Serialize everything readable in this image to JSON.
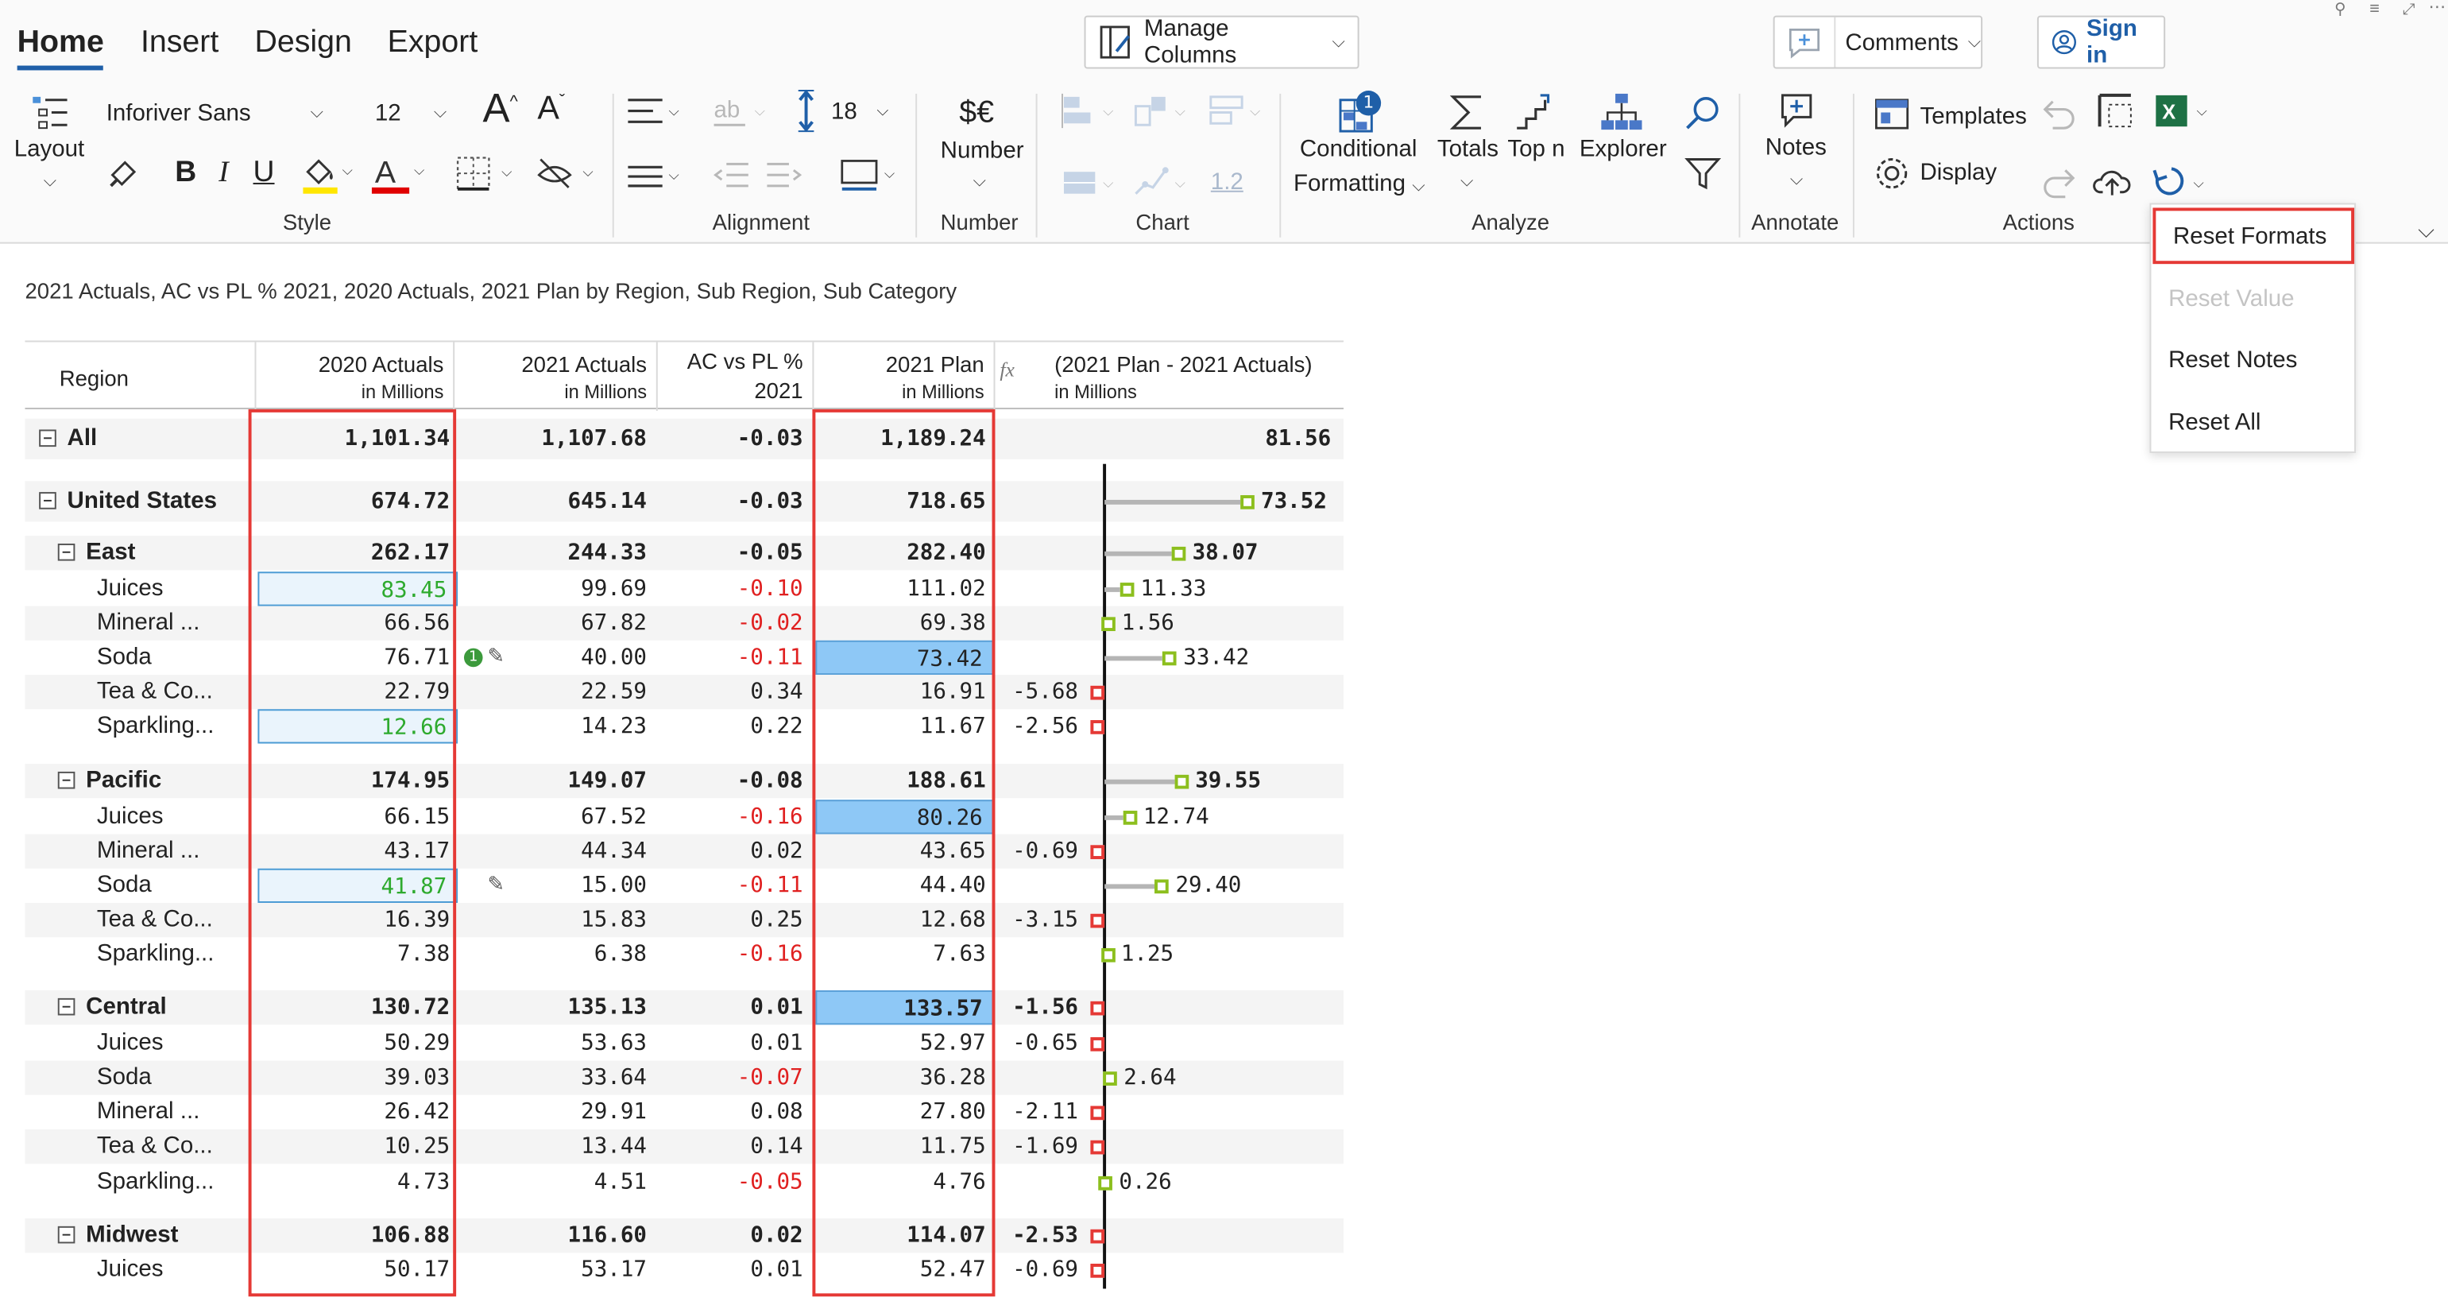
{
  "menu_tabs": [
    "Home",
    "Insert",
    "Design",
    "Export"
  ],
  "top": {
    "manage_columns": "Manage Columns",
    "comments": "Comments",
    "sign_in": "Sign in"
  },
  "style": {
    "layout_label": "Layout",
    "font_name": "Inforiver Sans",
    "font_size": "12",
    "bold": "B",
    "italic": "I",
    "underline": "U",
    "grow": "A",
    "shrink": "A",
    "group_label": "Style"
  },
  "alignment": {
    "row_height": "18",
    "group_label": "Alignment"
  },
  "number": {
    "symbol": "$€",
    "label": "Number",
    "group_label": "Number"
  },
  "chart": {
    "decimal": "1.2",
    "group_label": "Chart"
  },
  "analyze": {
    "conditional": "Conditional",
    "formatting": "Formatting",
    "badge": "1",
    "totals": "Totals",
    "topn": "Top n",
    "explorer": "Explorer",
    "group_label": "Analyze"
  },
  "annotate": {
    "notes": "Notes",
    "group_label": "Annotate"
  },
  "actions": {
    "templates": "Templates",
    "display": "Display",
    "group_label": "Actions",
    "excel": "X"
  },
  "reset_menu": [
    "Reset Formats",
    "Reset Value",
    "Reset Notes",
    "Reset All"
  ],
  "subtitle": "2021 Actuals, AC vs PL % 2021, 2020 Actuals, 2021 Plan by Region, Sub Region, Sub Category",
  "headers": {
    "region": "Region",
    "c2020_l1": "2020 Actuals",
    "c2020_l2": "in Millions",
    "c2021_l1": "2021 Actuals",
    "c2021_l2": "in Millions",
    "acpl_l1": "AC vs PL %",
    "acpl_l2": "2021",
    "plan_l1": "2021 Plan",
    "plan_l2": "in Millions",
    "fx": "fx",
    "diff_l1": "(2021 Plan - 2021 Actuals)",
    "diff_l2": "in Millions"
  },
  "rows": [
    {
      "label": "All",
      "level": 0,
      "a2020": "1,101.34",
      "a2021": "1,107.68",
      "acpl": "-0.03",
      "plan": "1,189.24",
      "diff": "81.56"
    },
    {
      "label": "United States",
      "level": 0,
      "a2020": "674.72",
      "a2021": "645.14",
      "acpl": "-0.03",
      "plan": "718.65",
      "diff": "73.52"
    },
    {
      "label": "East",
      "level": 1,
      "a2020": "262.17",
      "a2021": "244.33",
      "acpl": "-0.05",
      "plan": "282.40",
      "diff": "38.07"
    },
    {
      "label": "Juices",
      "level": 2,
      "a2020": "83.45",
      "a2021": "99.69",
      "acpl": "-0.10",
      "plan": "111.02",
      "diff": "11.33"
    },
    {
      "label": "Mineral ...",
      "level": 2,
      "a2020": "66.56",
      "a2021": "67.82",
      "acpl": "-0.02",
      "plan": "69.38",
      "diff": "1.56"
    },
    {
      "label": "Soda",
      "level": 2,
      "a2020": "76.71",
      "a2021": "40.00",
      "acpl": "-0.11",
      "plan": "73.42",
      "diff": "33.42"
    },
    {
      "label": "Tea & Co...",
      "level": 2,
      "a2020": "22.79",
      "a2021": "22.59",
      "acpl": "0.34",
      "plan": "16.91",
      "diff": "-5.68"
    },
    {
      "label": "Sparkling...",
      "level": 2,
      "a2020": "12.66",
      "a2021": "14.23",
      "acpl": "0.22",
      "plan": "11.67",
      "diff": "-2.56"
    },
    {
      "label": "Pacific",
      "level": 1,
      "a2020": "174.95",
      "a2021": "149.07",
      "acpl": "-0.08",
      "plan": "188.61",
      "diff": "39.55"
    },
    {
      "label": "Juices",
      "level": 2,
      "a2020": "66.15",
      "a2021": "67.52",
      "acpl": "-0.16",
      "plan": "80.26",
      "diff": "12.74"
    },
    {
      "label": "Mineral ...",
      "level": 2,
      "a2020": "43.17",
      "a2021": "44.34",
      "acpl": "0.02",
      "plan": "43.65",
      "diff": "-0.69"
    },
    {
      "label": "Soda",
      "level": 2,
      "a2020": "41.87",
      "a2021": "15.00",
      "acpl": "-0.11",
      "plan": "44.40",
      "diff": "29.40"
    },
    {
      "label": "Tea & Co...",
      "level": 2,
      "a2020": "16.39",
      "a2021": "15.83",
      "acpl": "0.25",
      "plan": "12.68",
      "diff": "-3.15"
    },
    {
      "label": "Sparkling...",
      "level": 2,
      "a2020": "7.38",
      "a2021": "6.38",
      "acpl": "-0.16",
      "plan": "7.63",
      "diff": "1.25"
    },
    {
      "label": "Central",
      "level": 1,
      "a2020": "130.72",
      "a2021": "135.13",
      "acpl": "0.01",
      "plan": "133.57",
      "diff": "-1.56"
    },
    {
      "label": "Juices",
      "level": 2,
      "a2020": "50.29",
      "a2021": "53.63",
      "acpl": "0.01",
      "plan": "52.97",
      "diff": "-0.65"
    },
    {
      "label": "Soda",
      "level": 2,
      "a2020": "39.03",
      "a2021": "33.64",
      "acpl": "-0.07",
      "plan": "36.28",
      "diff": "2.64"
    },
    {
      "label": "Mineral ...",
      "level": 2,
      "a2020": "26.42",
      "a2021": "29.91",
      "acpl": "0.08",
      "plan": "27.80",
      "diff": "-2.11"
    },
    {
      "label": "Tea & Co...",
      "level": 2,
      "a2020": "10.25",
      "a2021": "13.44",
      "acpl": "0.14",
      "plan": "11.75",
      "diff": "-1.69"
    },
    {
      "label": "Sparkling...",
      "level": 2,
      "a2020": "4.73",
      "a2021": "4.51",
      "acpl": "-0.05",
      "plan": "4.76",
      "diff": "0.26"
    },
    {
      "label": "Midwest",
      "level": 1,
      "a2020": "106.88",
      "a2021": "116.60",
      "acpl": "0.02",
      "plan": "114.07",
      "diff": "-2.53"
    },
    {
      "label": "Juices",
      "level": 2,
      "a2020": "50.17",
      "a2021": "53.17",
      "acpl": "0.01",
      "plan": "52.47",
      "diff": "-0.69"
    }
  ],
  "soda_note_badge": "1",
  "colors": {
    "accent": "#1f5fa8",
    "negative": "#e02020",
    "positive": "#2eaa2e",
    "highlight": "#e53935",
    "bar_pos": "#8cbf1e"
  }
}
